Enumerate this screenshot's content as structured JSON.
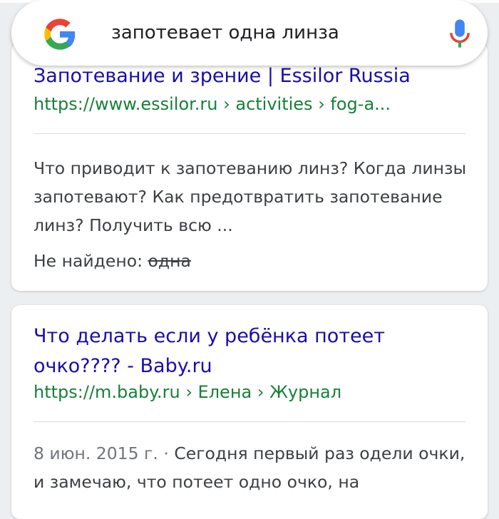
{
  "search": {
    "query": "запотевает одна линза",
    "logo_icon": "google-g-icon",
    "mic_icon": "microphone-icon"
  },
  "results": [
    {
      "title": "Запотевание и зрение | Essilor Russia",
      "url": "https://www.essilor.ru › activities › fog-a...",
      "snippet": "Что приводит к запотеванию линз? Когда линзы запотевают? Как предотвратить запотевание линз? Получить всю ...",
      "not_found_label": "Не найдено:",
      "not_found_term": "одна"
    },
    {
      "title": "Что делать если у ребёнка потеет очко???? - Baby.ru",
      "url": "https://m.baby.ru › Елена › Журнал",
      "date": "8 июн. 2015 г.",
      "separator": "·",
      "snippet": "Сегодня первый раз одели очки, и замечаю, что потеет одно очко, на"
    }
  ],
  "colors": {
    "title_link": "#1a0dab",
    "url_green": "#188038",
    "snippet_text": "#3c4043",
    "background": "#eceff1"
  }
}
